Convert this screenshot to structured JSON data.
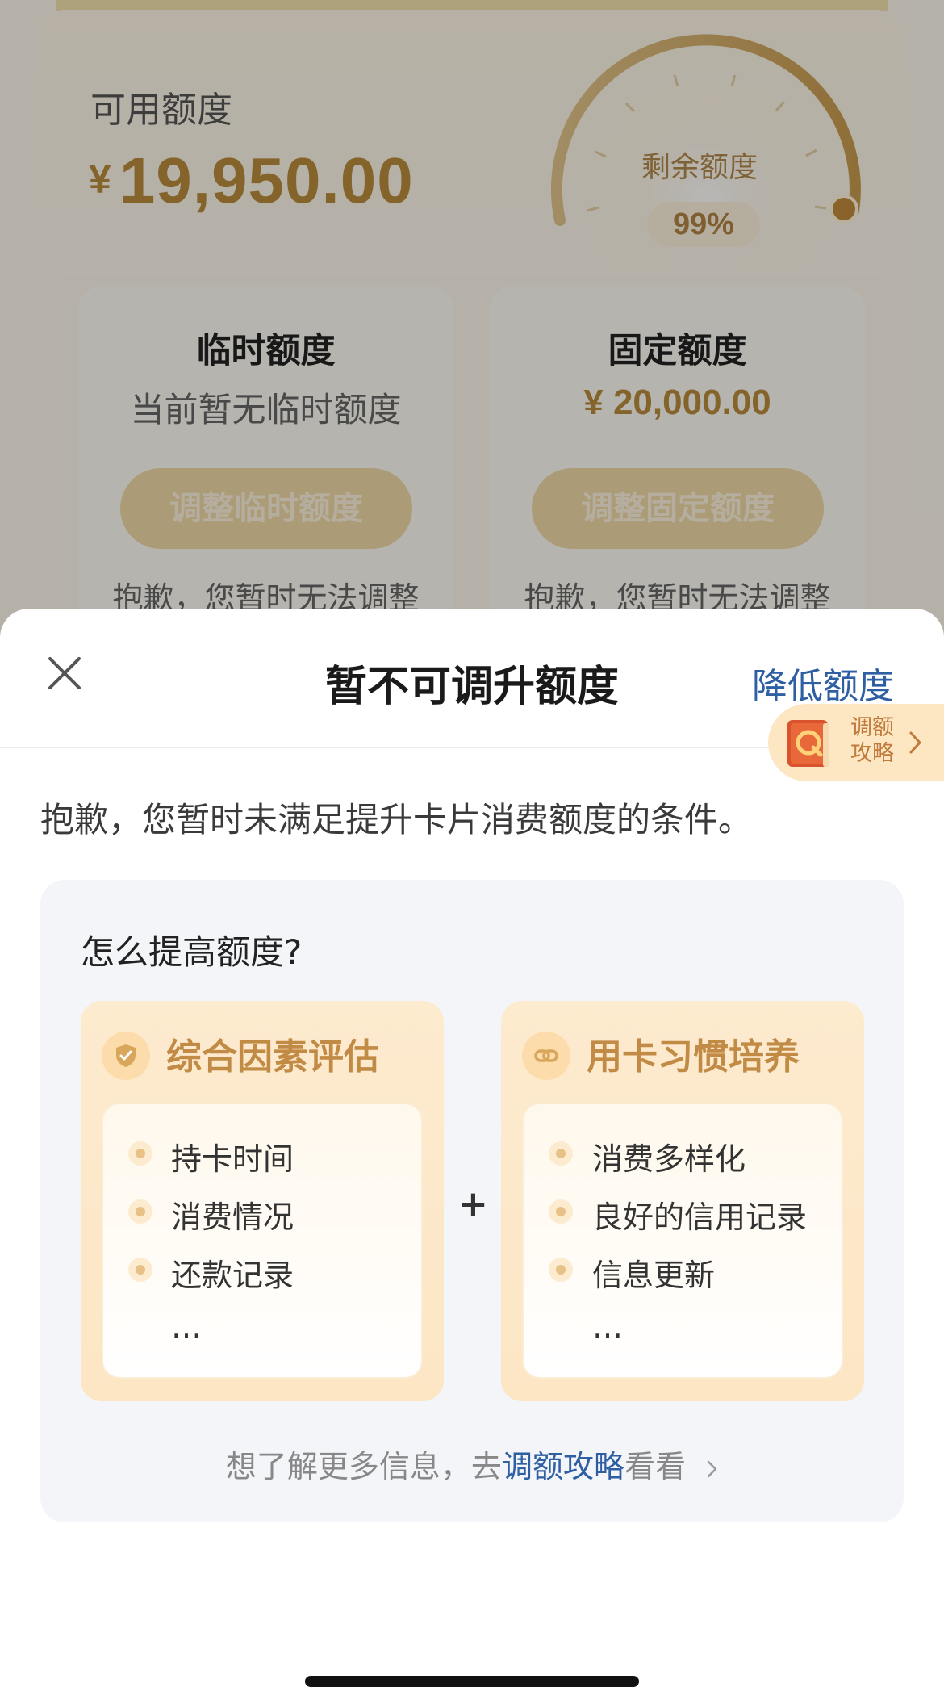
{
  "background": {
    "available": {
      "label": "可用额度",
      "currency": "¥",
      "amount": "19,950.00"
    },
    "gauge": {
      "label": "剩余额度",
      "percent_text": "99%",
      "percent": 99
    },
    "temporary": {
      "title": "临时额度",
      "desc": "当前暂无临时额度",
      "button": "调整临时额度",
      "note": "抱歉，您暂时无法调整"
    },
    "fixed": {
      "title": "固定额度",
      "amount": "¥ 20,000.00",
      "button": "调整固定额度",
      "note": "抱歉，您暂时无法调整"
    }
  },
  "sheet": {
    "title": "暂不可调升额度",
    "right_action": "降低额度",
    "guide_badge": {
      "line1": "调额",
      "line2": "攻略"
    },
    "sorry_text": "抱歉，您暂时未满足提升卡片消费额度的条件。",
    "how_title": "怎么提高额度?",
    "factors": [
      {
        "title": "综合因素评估",
        "icon": "shield-check-icon",
        "items": [
          "持卡时间",
          "消费情况",
          "还款记录",
          "…"
        ]
      },
      {
        "title": "用卡习惯培养",
        "icon": "link-icon",
        "items": [
          "消费多样化",
          "良好的信用记录",
          "信息更新",
          "…"
        ]
      }
    ],
    "plus": "+",
    "more_info": {
      "prefix": "想了解更多信息，去",
      "link": "调额攻略",
      "suffix": "看看"
    }
  },
  "colors": {
    "gold": "#b98b3e",
    "link_blue": "#2e5fa3",
    "panel_bg": "#f3f5f9"
  }
}
